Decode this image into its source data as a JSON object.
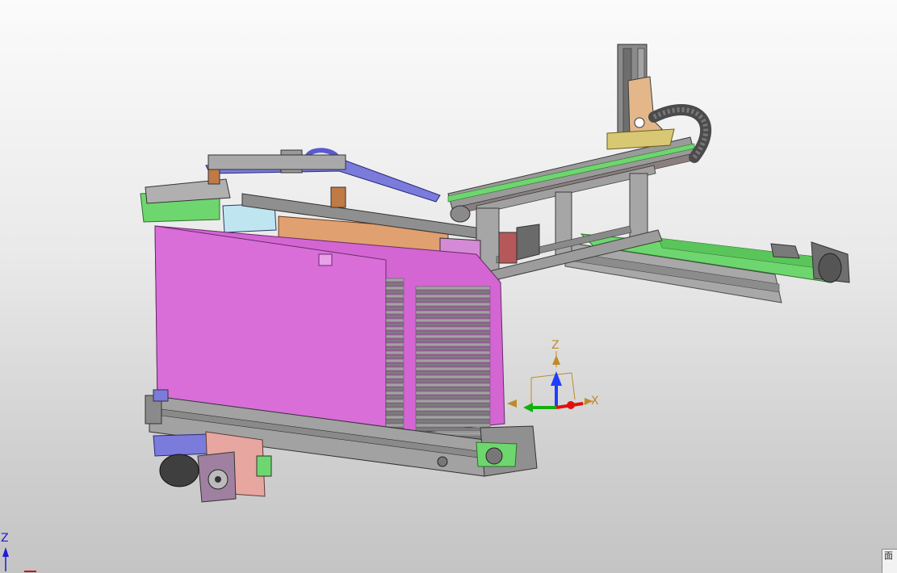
{
  "viewport": {
    "background_top": "#fbfbfb",
    "background_bottom": "#c4c4c4"
  },
  "model": {
    "colors": {
      "frame": "#9a9a9a",
      "frame_dark": "#5e5e5e",
      "panel_magenta": "#d366d3",
      "belt_green": "#6ed66e",
      "block_tan": "#e0a070",
      "guide_blue": "#7b7bdc",
      "bracket_brass": "#d9c873",
      "plate_pink": "#e7a6a0",
      "stack_gray": "#8c8c8c",
      "rail_cyan": "#bfe6f0"
    }
  },
  "triad": {
    "z_label": "Z",
    "x_label": "X",
    "z_color": "#c08a2a",
    "x_color": "#c08a2a",
    "z_axis": "#1f3dff",
    "x_axis": "#e01010",
    "y_axis": "#10b010"
  },
  "corner_triad": {
    "z_label": "Z",
    "color": "#1d1dd6"
  },
  "corner_panel": {
    "label": "面"
  }
}
